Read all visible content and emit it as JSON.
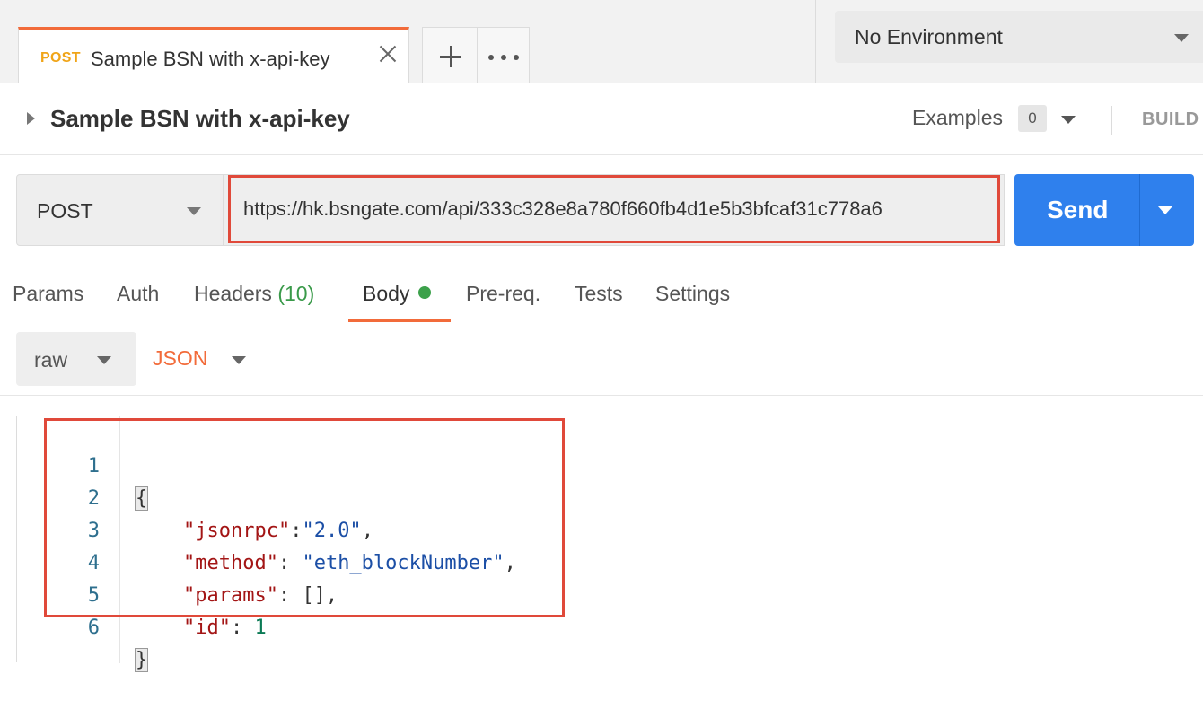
{
  "tab": {
    "method": "POST",
    "title": "Sample BSN with x-api-key"
  },
  "environment": {
    "selected": "No Environment"
  },
  "request": {
    "name": "Sample BSN with x-api-key",
    "examples_label": "Examples",
    "examples_count": "0",
    "build_label": "BUILD",
    "method": "POST",
    "url": "https://hk.bsngate.com/api/333c328e8a780f660fb4d1e5b3bfcaf31c778a6",
    "send_label": "Send"
  },
  "request_tabs": {
    "params": "Params",
    "auth": "Auth",
    "headers": "Headers",
    "headers_count": "(10)",
    "body": "Body",
    "prereq": "Pre-req.",
    "tests": "Tests",
    "settings": "Settings"
  },
  "body_options": {
    "mode": "raw",
    "language": "JSON"
  },
  "code": {
    "line_numbers": [
      "1",
      "2",
      "3",
      "4",
      "5",
      "6"
    ],
    "open_brace": "{",
    "close_brace": "}",
    "l2_key": "\"jsonrpc\"",
    "l2_sep": ":",
    "l2_val": "\"2.0\"",
    "l2_end": ",",
    "l3_key": "\"method\"",
    "l3_sep": ": ",
    "l3_val": "\"eth_blockNumber\"",
    "l3_end": ",",
    "l4_key": "\"params\"",
    "l4_rest": ": [],",
    "l5_key": "\"id\"",
    "l5_sep": ": ",
    "l5_val": "1"
  },
  "colors": {
    "accent": "#f26b3a",
    "send": "#2f80ed",
    "highlight_box": "#e0493a",
    "body_dot": "#3ca14b",
    "method_post": "#f0a418"
  }
}
